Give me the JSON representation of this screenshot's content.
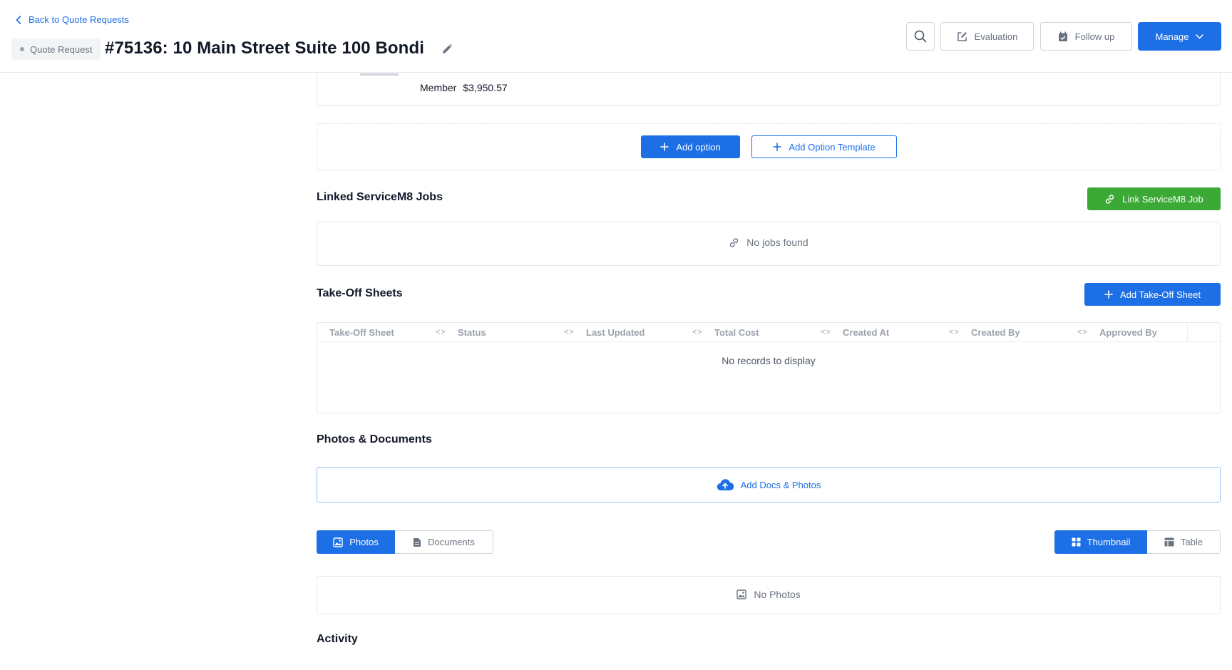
{
  "header": {
    "back_label": "Back to Quote Requests",
    "status_pill": "Quote Request",
    "title": "#75136: 10 Main Street Suite 100 Bondi",
    "buttons": {
      "evaluation": "Evaluation",
      "follow_up": "Follow up",
      "manage": "Manage"
    }
  },
  "summary": {
    "member_label": "Member",
    "member_value": "$3,950.57"
  },
  "options": {
    "add_option": "Add option",
    "add_option_template": "Add Option Template"
  },
  "linked_jobs": {
    "title": "Linked ServiceM8 Jobs",
    "link_button": "Link ServiceM8 Job",
    "empty": "No jobs found"
  },
  "takeoff": {
    "title": "Take-Off Sheets",
    "add_button": "Add Take-Off Sheet",
    "columns": [
      "Take-Off Sheet",
      "Status",
      "Last Updated",
      "Total Cost",
      "Created At",
      "Created By",
      "Approved By"
    ],
    "empty": "No records to display"
  },
  "photos_docs": {
    "title": "Photos & Documents",
    "upload": "Add Docs & Photos",
    "tabs": [
      "Photos",
      "Documents"
    ],
    "views": [
      "Thumbnail",
      "Table"
    ],
    "empty": "No Photos"
  },
  "activity": {
    "title": "Activity"
  },
  "colors": {
    "primary": "#1d6fe6",
    "success": "#3aa935",
    "border": "#e5e7eb",
    "muted_text": "#6b7280"
  }
}
